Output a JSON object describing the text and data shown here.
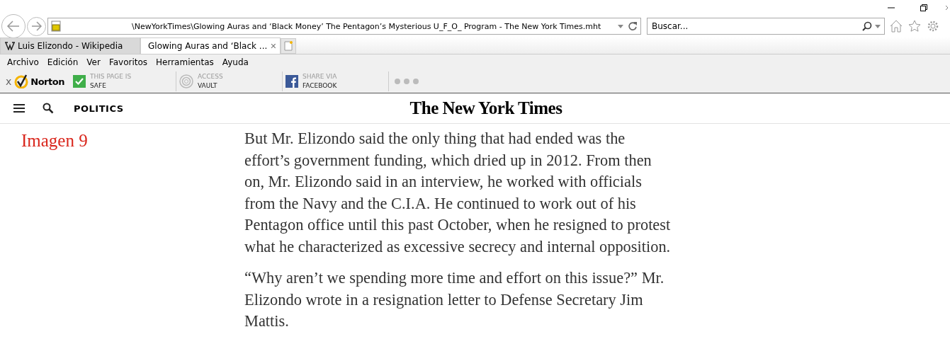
{
  "address_bar": {
    "value": "\\NewYorkTimes\\Glowing Auras and ‘Black Money’ The Pentagon’s Mysterious U_F_O_ Program - The New York Times.mht"
  },
  "search": {
    "placeholder": "Buscar..."
  },
  "tabs": [
    {
      "label": "Luis Elizondo - Wikipedia",
      "selected": false,
      "kind": "wiki"
    },
    {
      "label": "Glowing Auras and ‘Black ...",
      "selected": true,
      "kind": "ie",
      "close": "✕"
    }
  ],
  "menu": [
    "Archivo",
    "Edición",
    "Ver",
    "Favoritos",
    "Herramientas",
    "Ayuda"
  ],
  "norton_toolbar": {
    "close": "x",
    "logo": "Norton",
    "items": [
      {
        "kind": "safe",
        "line_1": "THIS PAGE IS",
        "line_2": "SAFE"
      },
      {
        "kind": "vault",
        "line_1": "ACCESS",
        "line_2": "VAULT"
      },
      {
        "kind": "facebook",
        "line_1": "SHARE VIA",
        "line_2": "FACEBOOK"
      }
    ]
  },
  "site_header": {
    "section": "POLITICS",
    "masthead": "The New York Times"
  },
  "caption": "Imagen 9",
  "paragraphs": [
    "But Mr. Elizondo said the only thing that had ended was the effort’s government funding, which dried up in 2012. From then on, Mr. Elizondo said in an interview, he worked with officials from the Navy and the C.I.A. He continued to work out of his Pentagon office until this past October, when he resigned to protest what he characterized as excessive secrecy and internal opposition.",
    "“Why aren’t we spending more time and effort on this issue?” Mr. Elizondo wrote in a resignation letter to Defense Secretary Jim Mattis."
  ]
}
